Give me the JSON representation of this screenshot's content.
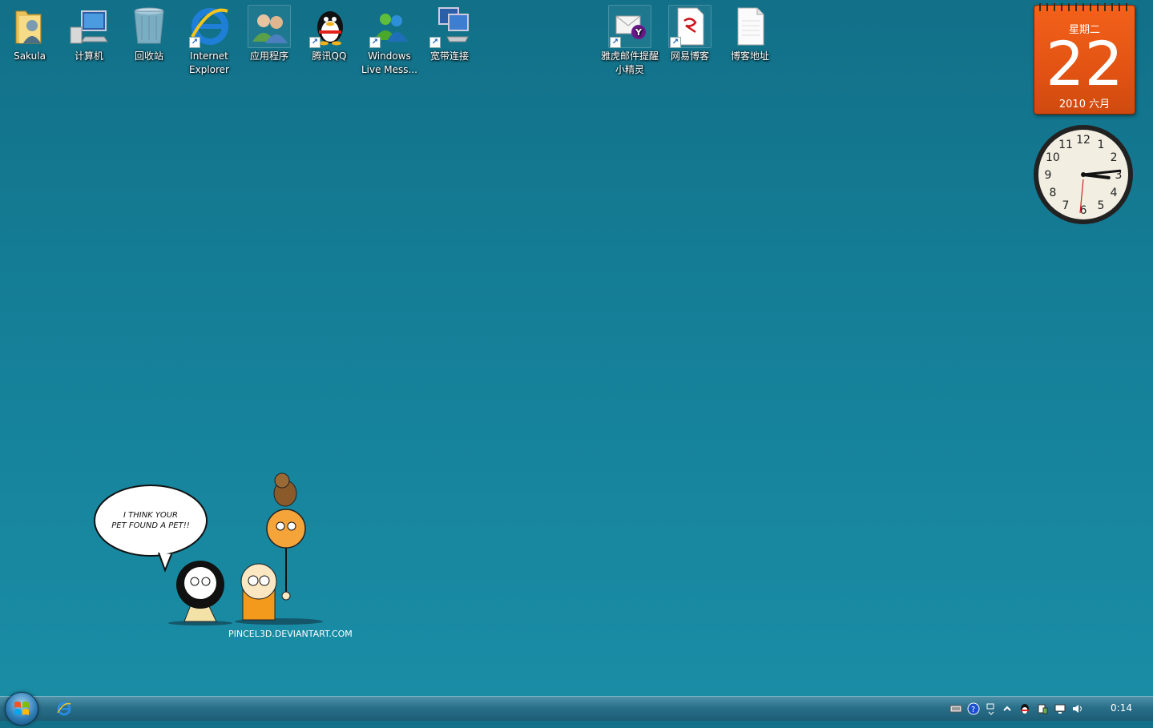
{
  "desktop": {
    "icons": [
      {
        "label": "Sakula"
      },
      {
        "label": "计算机"
      },
      {
        "label": "回收站"
      },
      {
        "label": "Internet Explorer"
      },
      {
        "label": "应用程序"
      },
      {
        "label": "腾讯QQ"
      },
      {
        "label": "Windows Live Mess..."
      },
      {
        "label": "宽带连接"
      },
      {
        "label": "雅虎邮件提醒小精灵"
      },
      {
        "label": "网易博客"
      },
      {
        "label": "博客地址"
      }
    ]
  },
  "calendar": {
    "weekday": "星期二",
    "day": "22",
    "month_year": "2010 六月"
  },
  "clock": {
    "numbers": [
      "12",
      "1",
      "2",
      "3",
      "4",
      "5",
      "6",
      "7",
      "8",
      "9",
      "10",
      "11"
    ],
    "hour": 3,
    "minute": 14
  },
  "wallpaper": {
    "bubble_line1": "I THINK YOUR",
    "bubble_line2": "PET FOUND A PET!!",
    "credit": "PINCEL3D.DEVIANTART.COM"
  },
  "taskbar": {
    "time": "0:14"
  }
}
